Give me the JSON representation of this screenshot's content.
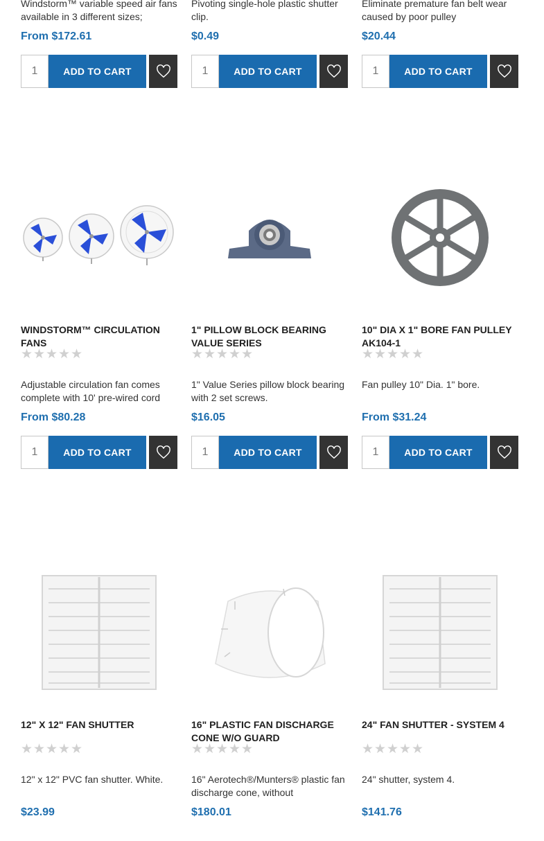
{
  "rows": [
    {
      "products": [
        {
          "title": "",
          "desc": "Windstorm™ variable speed air fans available in 3 different sizes;",
          "price": "From $172.61"
        },
        {
          "title": "",
          "desc": "Pivoting single-hole plastic shutter clip.",
          "price": "$0.49"
        },
        {
          "title": "",
          "desc": "Eliminate premature fan belt wear caused by poor pulley",
          "price": "$20.44"
        }
      ]
    },
    {
      "products": [
        {
          "title": "Windstorm™ Circulation Fans",
          "desc": "Adjustable circulation fan comes complete with 10' pre-wired cord",
          "price": "From $80.28",
          "image": "fans-image"
        },
        {
          "title": "1\" Pillow Block Bearing Value Series",
          "desc": "1\" Value Series pillow block bearing with 2 set screws.",
          "price": "$16.05",
          "image": "bearing-image"
        },
        {
          "title": "10\" Dia x 1\" Bore Fan Pulley AK104-1",
          "desc": "Fan pulley 10\" Dia. 1\" bore.",
          "price": "From $31.24",
          "image": "pulley-image"
        }
      ]
    },
    {
      "products": [
        {
          "title": "12\" x 12\" Fan Shutter",
          "desc": "12\" x 12\" PVC fan shutter. White.",
          "price": "$23.99",
          "image": "shutter-image"
        },
        {
          "title": "16\" Plastic Fan Discharge Cone w/o Guard",
          "desc": "16\" Aerotech®/Munters® plastic fan discharge cone, without",
          "price": "$180.01",
          "image": "cone-image"
        },
        {
          "title": "24\" Fan Shutter - System 4",
          "desc": "24\" shutter, system 4.",
          "price": "$141.76",
          "image": "shutter-image"
        }
      ]
    }
  ],
  "actions": {
    "qty_value": "1",
    "add_to_cart": "Add to Cart"
  },
  "icons": {
    "wishlist": "heart-icon",
    "rating": "star-icon"
  },
  "colors": {
    "price": "#1f6faf",
    "add_to_cart_bg": "#1a6baf",
    "wishlist_bg": "#333333"
  }
}
